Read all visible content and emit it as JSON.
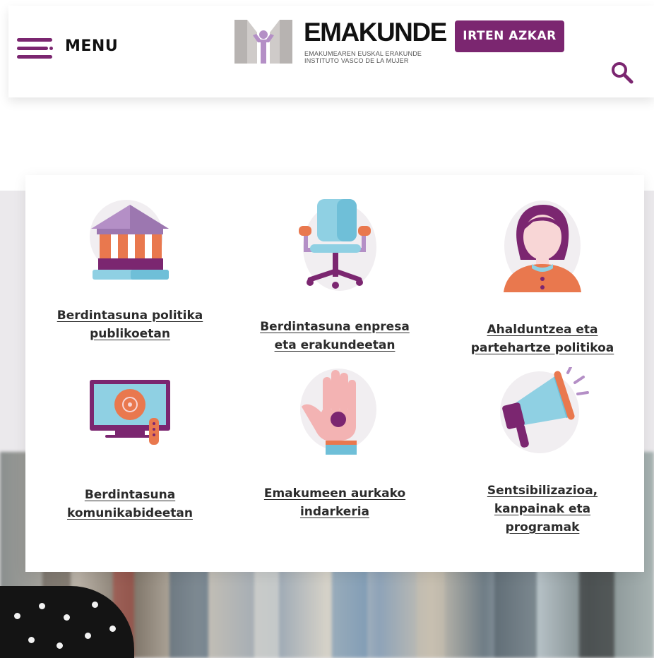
{
  "header": {
    "menu_label": "MENU",
    "logo": {
      "name": "EMAKUNDE",
      "subtitle_line1": "EMAKUMEAREN EUSKAL ERAKUNDE",
      "subtitle_line2": "INSTITUTO VASCO DE LA MUJER"
    },
    "exit_button_label": "IRTEN AZKAR"
  },
  "categories": [
    {
      "label": "Berdintasuna politika\npublikoetan",
      "icon": "government-building-icon"
    },
    {
      "label": "Berdintasuna enpresa\neta erakundeetan",
      "icon": "office-chair-icon"
    },
    {
      "label": "Ahalduntzea eta\npartehartze politikoa",
      "icon": "woman-avatar-icon"
    },
    {
      "label": "Berdintasuna\nkomunikabideetan",
      "icon": "television-icon"
    },
    {
      "label": "Emakumeen aurkako\nindarkeria",
      "icon": "raised-hand-icon"
    },
    {
      "label": "Sentsibilizazioa,\nkanpainak eta\nprogramak",
      "icon": "megaphone-icon"
    }
  ],
  "colors": {
    "brand_purple": "#7b2670",
    "orange": "#e9784e",
    "light_blue": "#8fd0e3",
    "lilac": "#b48fc6"
  }
}
